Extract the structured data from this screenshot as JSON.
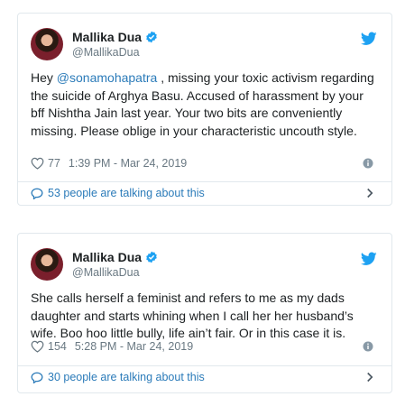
{
  "tweets": [
    {
      "display_name": "Mallika Dua",
      "handle": "@MallikaDua",
      "text_prefix": "Hey ",
      "mention": "@sonamohapatra",
      "text_suffix": " , missing your toxic activism regarding the suicide of Arghya Basu. Accused of harassment by your bff Nishtha Jain last year. Your two bits are conveniently missing. Please oblige in your characteristic uncouth style.",
      "likes": "77",
      "timestamp": "1:39 PM - Mar 24, 2019",
      "talking": "53 people are talking about this"
    },
    {
      "display_name": "Mallika Dua",
      "handle": "@MallikaDua",
      "text_prefix": "She calls herself a feminist and refers to me as my dads daughter and starts whining when I call her her husband’s wife. Boo hoo little bully, life ain’t fair. Or in this case it is.",
      "mention": "",
      "text_suffix": "",
      "likes": "154",
      "timestamp": "5:28 PM - Mar 24, 2019",
      "talking": "30 people are talking about this"
    }
  ],
  "colors": {
    "link": "#2b7bb9",
    "muted": "#697882",
    "border": "#e1e8ed",
    "twitter_blue": "#1da1f2"
  },
  "icons": [
    "avatar",
    "verified-icon",
    "twitter-bird-icon",
    "heart-icon",
    "info-icon",
    "speech-bubble-icon",
    "chevron-right-icon"
  ]
}
